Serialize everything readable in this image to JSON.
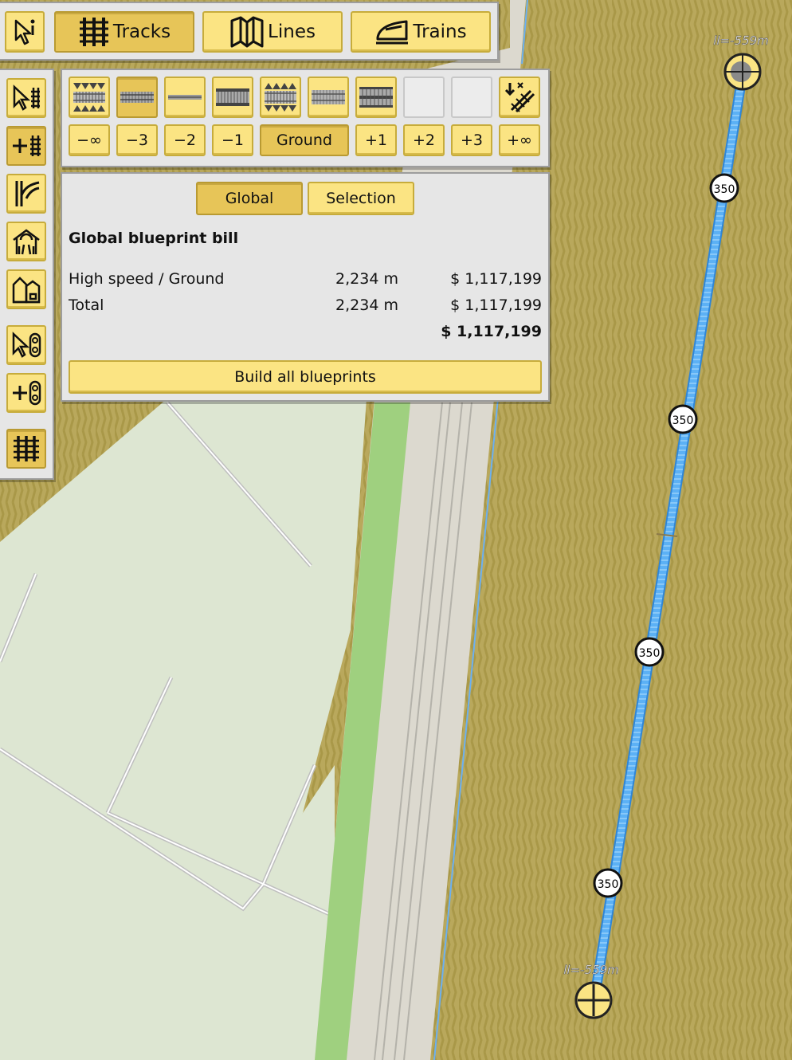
{
  "top_tabs": [
    {
      "id": "info",
      "label": "",
      "icon": "pointer-info-icon",
      "active": false
    },
    {
      "id": "tracks",
      "label": "Tracks",
      "icon": "tracks-icon",
      "active": true
    },
    {
      "id": "lines",
      "label": "Lines",
      "icon": "map-lines-icon",
      "active": false
    },
    {
      "id": "trains",
      "label": "Trains",
      "icon": "train-icon",
      "active": false
    }
  ],
  "side_tools": [
    {
      "id": "select-track",
      "icon": "select-track-icon",
      "active": false
    },
    {
      "id": "add-track",
      "icon": "add-track-icon",
      "active": true
    },
    {
      "id": "switch",
      "icon": "track-switch-icon",
      "active": false
    },
    {
      "id": "station",
      "icon": "station-icon",
      "active": false
    },
    {
      "id": "depot",
      "icon": "depot-icon",
      "active": false
    },
    {
      "id": "select-signal",
      "icon": "select-signal-icon",
      "active": false
    },
    {
      "id": "add-signal",
      "icon": "add-signal-icon",
      "active": false
    },
    {
      "id": "blueprints",
      "icon": "blueprint-tracks-icon",
      "active": true
    }
  ],
  "track_types": [
    {
      "id": "tt1",
      "icon": "track-high-embankment-icon",
      "active": false
    },
    {
      "id": "tt2",
      "icon": "track-high-speed-icon",
      "active": true
    },
    {
      "id": "tt3",
      "icon": "track-light-icon",
      "active": false
    },
    {
      "id": "tt4",
      "icon": "track-standard-icon",
      "active": false
    },
    {
      "id": "tt5",
      "icon": "track-embankment-icon",
      "active": false
    },
    {
      "id": "tt6",
      "icon": "track-gravel-icon",
      "active": false
    },
    {
      "id": "tt7",
      "icon": "track-double-icon",
      "active": false
    },
    {
      "id": "tt8",
      "icon": "",
      "active": false,
      "empty": true
    },
    {
      "id": "tt9",
      "icon": "",
      "active": false,
      "empty": true
    },
    {
      "id": "tt10",
      "icon": "demolish-track-icon",
      "active": false
    }
  ],
  "levels": [
    {
      "label": "−∞",
      "active": false
    },
    {
      "label": "−3",
      "active": false
    },
    {
      "label": "−2",
      "active": false
    },
    {
      "label": "−1",
      "active": false
    },
    {
      "label": "Ground",
      "active": true
    },
    {
      "label": "+1",
      "active": false
    },
    {
      "label": "+2",
      "active": false
    },
    {
      "label": "+3",
      "active": false
    },
    {
      "label": "+∞",
      "active": false
    }
  ],
  "bill": {
    "tabs": [
      {
        "label": "Global",
        "active": true
      },
      {
        "label": "Selection",
        "active": false
      }
    ],
    "title": "Global blueprint bill",
    "rows": [
      {
        "name": "High speed / Ground",
        "length": "2,234 m",
        "cost": "$ 1,117,199"
      },
      {
        "name": "Total",
        "length": "2,234 m",
        "cost": "$ 1,117,199"
      }
    ],
    "grand_total": "$ 1,117,199",
    "build_label": "Build all blueprints"
  },
  "map": {
    "speed_badge": "350",
    "elevation_top": "ll=-559m",
    "elevation_bottom": "ll=-559m",
    "colors": {
      "field": "#b9a85c",
      "meadow": "#dbe4cf",
      "rail_bed": "#dcd9cf",
      "green_strip": "#9bcf7d",
      "blueprint": "#55aaf0"
    }
  }
}
